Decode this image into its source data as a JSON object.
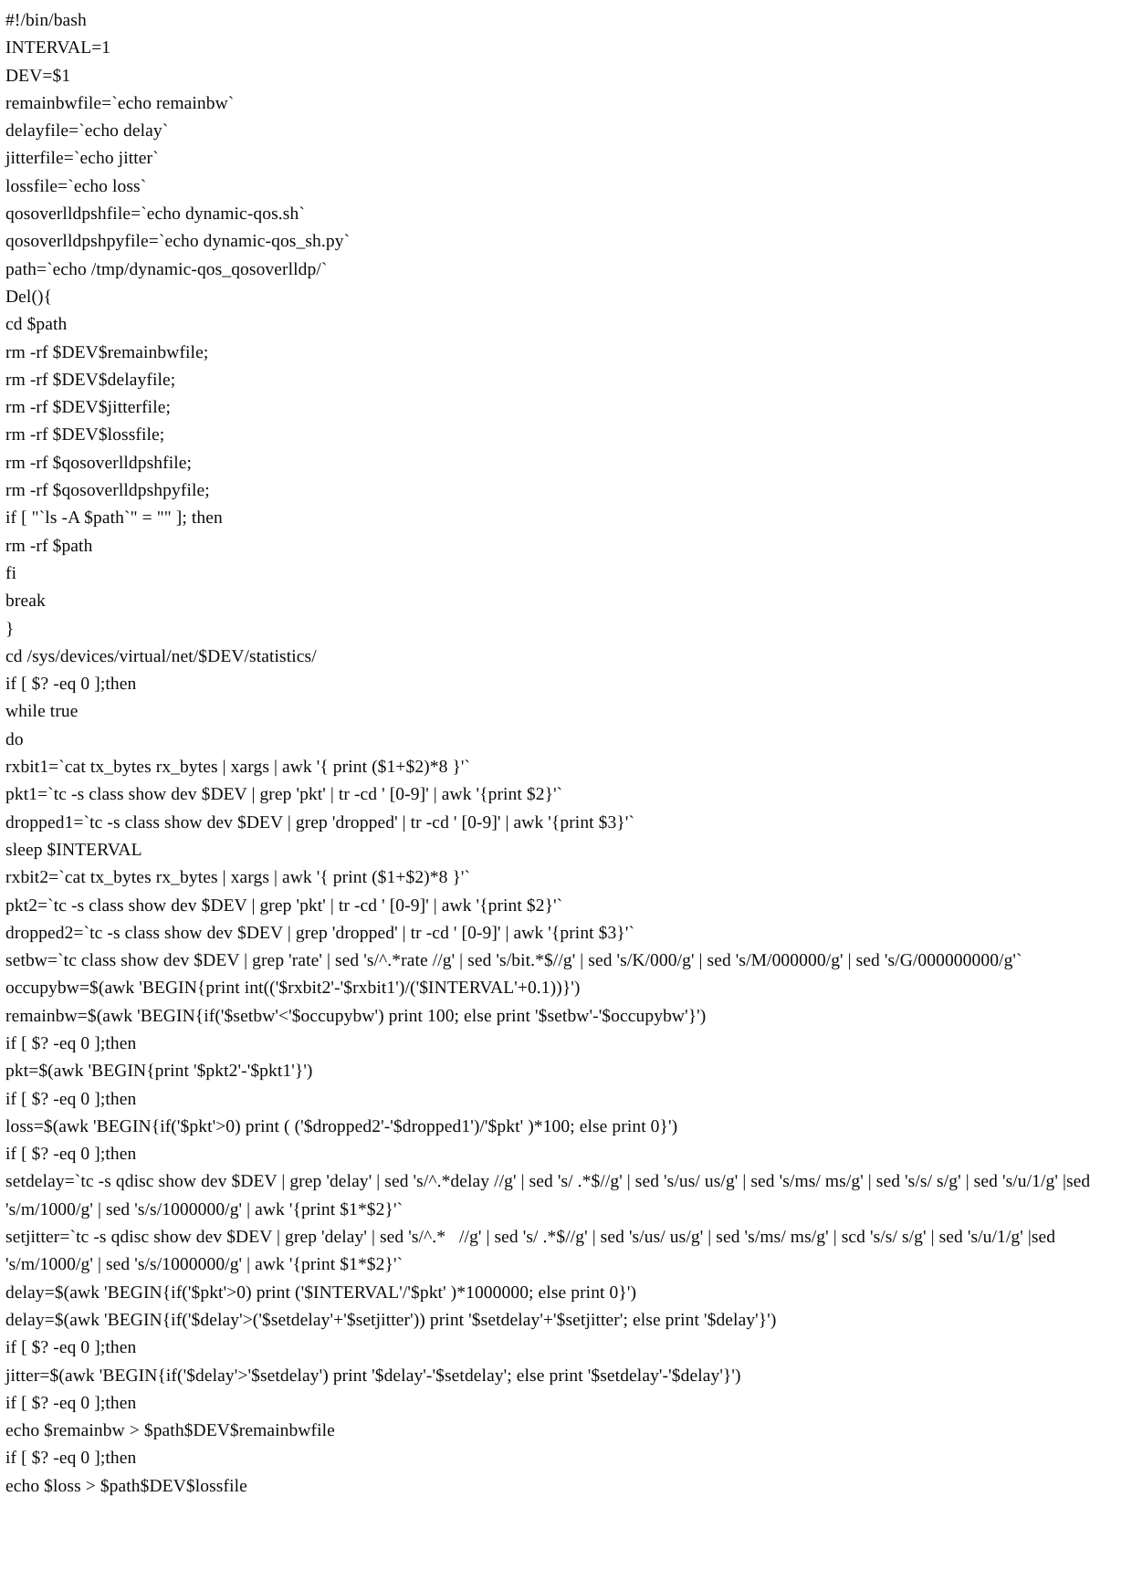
{
  "document": {
    "type": "source-code-listing",
    "language": "bash",
    "page_background": "#ffffff",
    "text_color": "#000000",
    "lines": [
      "#!/bin/bash",
      "INTERVAL=1",
      "DEV=$1",
      "remainbwfile=`echo remainbw`",
      "delayfile=`echo delay`",
      "jitterfile=`echo jitter`",
      "lossfile=`echo loss`",
      "qosoverlldpshfile=`echo dynamic-qos.sh`",
      "qosoverlldpshpyfile=`echo dynamic-qos_sh.py`",
      "path=`echo /tmp/dynamic-qos_qosoverlldp/`",
      "Del(){",
      "cd $path",
      "rm -rf $DEV$remainbwfile;",
      "rm -rf $DEV$delayfile;",
      "rm -rf $DEV$jitterfile;",
      "rm -rf $DEV$lossfile;",
      "rm -rf $qosoverlldpshfile;",
      "rm -rf $qosoverlldpshpyfile;",
      "if [ \"`ls -A $path`\" = \"\" ]; then",
      "rm -rf $path",
      "fi",
      "break",
      "}",
      "cd /sys/devices/virtual/net/$DEV/statistics/",
      "if [ $? -eq 0 ];then",
      "while true",
      "do",
      "rxbit1=`cat tx_bytes rx_bytes | xargs | awk '{ print ($1+$2)*8 }'`",
      "pkt1=`tc -s class show dev $DEV | grep 'pkt' | tr -cd ' [0-9]' | awk '{print $2}'`",
      "dropped1=`tc -s class show dev $DEV | grep 'dropped' | tr -cd ' [0-9]' | awk '{print $3}'`",
      "sleep $INTERVAL",
      "rxbit2=`cat tx_bytes rx_bytes | xargs | awk '{ print ($1+$2)*8 }'`",
      "pkt2=`tc -s class show dev $DEV | grep 'pkt' | tr -cd ' [0-9]' | awk '{print $2}'`",
      "dropped2=`tc -s class show dev $DEV | grep 'dropped' | tr -cd ' [0-9]' | awk '{print $3}'`",
      "setbw=`tc class show dev $DEV | grep 'rate' | sed 's/^.*rate //g' | sed 's/bit.*$//g' | sed 's/K/000/g' | sed 's/M/000000/g' | sed 's/G/000000000/g'`",
      "occupybw=$(awk 'BEGIN{print int(('$rxbit2'-'$rxbit1')/('$INTERVAL'+0.1))}')",
      "remainbw=$(awk 'BEGIN{if('$setbw'<'$occupybw') print 100; else print '$setbw'-'$occupybw'}')",
      "if [ $? -eq 0 ];then",
      "pkt=$(awk 'BEGIN{print '$pkt2'-'$pkt1'}')",
      "if [ $? -eq 0 ];then",
      "loss=$(awk 'BEGIN{if('$pkt'>0) print ( ('$dropped2'-'$dropped1')/'$pkt' )*100; else print 0}')",
      "if [ $? -eq 0 ];then",
      "setdelay=`tc -s qdisc show dev $DEV | grep 'delay' | sed 's/^.*delay //g' | sed 's/ .*$//g' | sed 's/us/ us/g' | sed 's/ms/ ms/g' | sed 's/s/ s/g' | sed 's/u/1/g' |sed 's/m/1000/g' | sed 's/s/1000000/g' | awk '{print $1*$2}'`",
      "setjitter=`tc -s qdisc show dev $DEV | grep 'delay' | sed 's/^.*   //g' | sed 's/ .*$//g' | sed 's/us/ us/g' | sed 's/ms/ ms/g' | scd 's/s/ s/g' | sed 's/u/1/g' |sed 's/m/1000/g' | sed 's/s/1000000/g' | awk '{print $1*$2}'`",
      "delay=$(awk 'BEGIN{if('$pkt'>0) print ('$INTERVAL'/'$pkt' )*1000000; else print 0}')",
      "delay=$(awk 'BEGIN{if('$delay'>('$setdelay'+'$setjitter')) print '$setdelay'+'$setjitter'; else print '$delay'}')",
      "if [ $? -eq 0 ];then",
      "jitter=$(awk 'BEGIN{if('$delay'>'$setdelay') print '$delay'-'$setdelay'; else print '$setdelay'-'$delay'}')",
      "if [ $? -eq 0 ];then",
      "echo $remainbw > $path$DEV$remainbwfile",
      "if [ $? -eq 0 ];then",
      "echo $loss > $path$DEV$lossfile"
    ]
  }
}
